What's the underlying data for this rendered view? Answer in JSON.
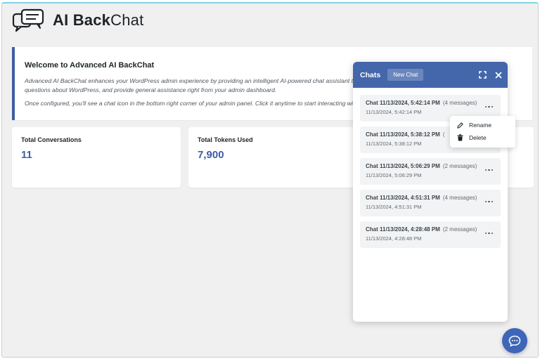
{
  "brand": {
    "name_bold": "AI Back",
    "name_regular": "Chat"
  },
  "welcome": {
    "title": "Welcome to Advanced AI BackChat",
    "line1": "Advanced AI BackChat enhances your WordPress admin experience by providing an intelligent AI-powered chat assistant that can help you with content creation, answer",
    "line2": "questions about WordPress, and provide general assistance right from your admin dashboard.",
    "line3": "Once configured, you'll see a chat icon in the bottom right corner of your admin panel. Click it anytime to start interacting with your AI assistant."
  },
  "stats": [
    {
      "label": "Total Conversations",
      "value": "11"
    },
    {
      "label": "Total Tokens Used",
      "value": "7,900"
    }
  ],
  "chat": {
    "title": "Chats",
    "new_chat_label": "New Chat",
    "items": [
      {
        "title": "Chat 11/13/2024, 5:42:14 PM",
        "count": "(4 messages)",
        "date": "11/13/2024, 5:42:14 PM"
      },
      {
        "title": "Chat 11/13/2024, 5:38:12 PM",
        "count": "(",
        "date": "11/13/2024, 5:38:12 PM"
      },
      {
        "title": "Chat 11/13/2024, 5:06:29 PM",
        "count": "(2 messages)",
        "date": "11/13/2024, 5:06:29 PM"
      },
      {
        "title": "Chat 11/13/2024, 4:51:31 PM",
        "count": "(4 messages)",
        "date": "11/13/2024, 4:51:31 PM"
      },
      {
        "title": "Chat 11/13/2024, 4:28:48 PM",
        "count": "(2 messages)",
        "date": "11/13/2024, 4:28:48 PM"
      }
    ]
  },
  "menu": {
    "rename": "Rename",
    "delete": "Delete"
  },
  "icons": {
    "logo": "chat-bubbles-icon",
    "expand": "expand-icon",
    "close": "close-icon",
    "more": "more-horizontal-icon",
    "rename": "pencil-icon",
    "delete": "trash-icon",
    "fab": "chat-bubble-icon"
  },
  "colors": {
    "accent": "#4466aa",
    "value": "#3e5fa3",
    "fab": "#3e66b8"
  }
}
